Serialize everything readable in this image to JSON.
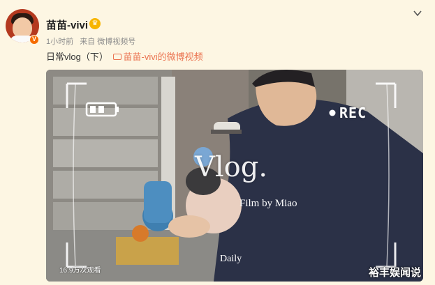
{
  "post": {
    "username": "苗苗-vivi",
    "verified_badge": "V",
    "meta": {
      "time": "1小时前",
      "source": "来自 微博视频号"
    },
    "text": "日常vlog（下）",
    "link_label": "苗苗-vivi的微博视频"
  },
  "video": {
    "rec_label": "REC",
    "title": "Vlog.",
    "credit": "Film by Miao",
    "caption": "Daily",
    "play_count": "16.9万次观看"
  },
  "watermark": "裕丰娱闻说",
  "colors": {
    "background": "#fdf6e3",
    "link": "#eb7350",
    "badge": "#f56b00",
    "crown": "#f7b500"
  },
  "icons": [
    "avatar",
    "verified-badge-icon",
    "crown-icon",
    "chevron-down-icon",
    "video-link-icon",
    "battery-icon",
    "rec-dot-icon"
  ]
}
